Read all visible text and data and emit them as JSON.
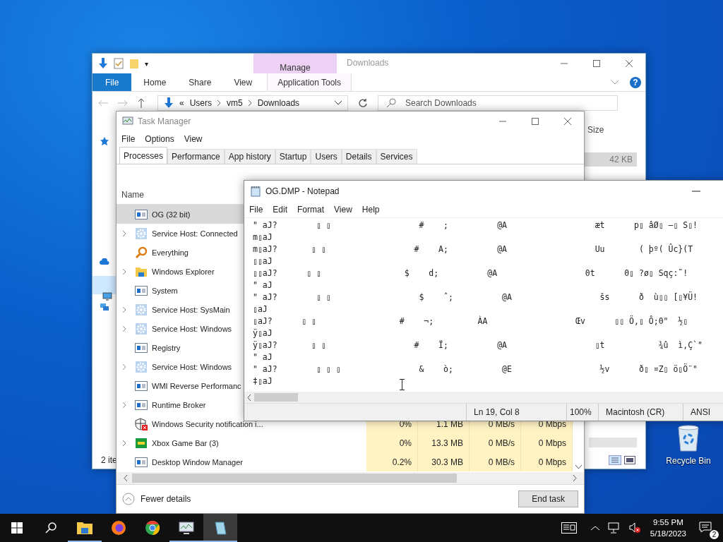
{
  "explorer": {
    "title": "Downloads",
    "context_tab": "Manage",
    "qat_caret": "▾",
    "ribbon_tabs": [
      {
        "label": "File",
        "kind": "file"
      },
      {
        "label": "Home",
        "kind": "plain"
      },
      {
        "label": "Share",
        "kind": "plain"
      },
      {
        "label": "View",
        "kind": "plain"
      },
      {
        "label": "Application Tools",
        "kind": "context"
      }
    ],
    "help": "?",
    "address_prefix": "«",
    "address": [
      "Users",
      "vm5",
      "Downloads"
    ],
    "search": {
      "placeholder": "Search Downloads"
    },
    "size_header": "Size",
    "files": [
      {
        "size": "42 KB",
        "selected": true
      }
    ],
    "status": "2 ite"
  },
  "task_manager": {
    "title": "Task Manager",
    "menu": [
      "File",
      "Options",
      "View"
    ],
    "tabs": [
      {
        "label": "Processes",
        "selected": true
      },
      {
        "label": "Performance",
        "selected": false
      },
      {
        "label": "App history",
        "selected": false
      },
      {
        "label": "Startup",
        "selected": false
      },
      {
        "label": "Users",
        "selected": false
      },
      {
        "label": "Details",
        "selected": false
      },
      {
        "label": "Services",
        "selected": false
      }
    ],
    "name_header": "Name",
    "processes": [
      {
        "name": "OG (32 bit)",
        "kind": "app",
        "expandable": false,
        "selected": true
      },
      {
        "name": "Service Host: Connected",
        "kind": "service",
        "expandable": true,
        "selected": false
      },
      {
        "name": "Everything",
        "kind": "search",
        "expandable": false,
        "selected": false
      },
      {
        "name": "Windows Explorer",
        "kind": "folder",
        "expandable": true,
        "selected": false
      },
      {
        "name": "System",
        "kind": "app",
        "expandable": false,
        "selected": false
      },
      {
        "name": "Service Host: SysMain",
        "kind": "service",
        "expandable": true,
        "selected": false
      },
      {
        "name": "Service Host: Windows",
        "kind": "service",
        "expandable": true,
        "selected": false
      },
      {
        "name": "Registry",
        "kind": "app",
        "expandable": false,
        "selected": false
      },
      {
        "name": "Service Host: Windows",
        "kind": "service",
        "expandable": true,
        "selected": false
      },
      {
        "name": "WMI Reverse Performanc",
        "kind": "app",
        "expandable": false,
        "selected": false
      },
      {
        "name": "Runtime Broker",
        "kind": "app",
        "expandable": true,
        "selected": false
      },
      {
        "name": "Windows Security notification i...",
        "kind": "shield",
        "expandable": false,
        "selected": false,
        "values": [
          "0%",
          "1.1 MB",
          "0 MB/s",
          "0 Mbps"
        ]
      },
      {
        "name": "Xbox Game Bar (3)",
        "kind": "game",
        "expandable": true,
        "selected": false,
        "values": [
          "0%",
          "13.3 MB",
          "0 MB/s",
          "0 Mbps"
        ]
      },
      {
        "name": "Desktop Window Manager",
        "kind": "app",
        "expandable": false,
        "selected": false,
        "values": [
          "0.2%",
          "30.3 MB",
          "0 MB/s",
          "0 Mbps"
        ]
      }
    ],
    "fewer_details": "Fewer details",
    "end_task": "End task"
  },
  "notepad": {
    "title": "OG.DMP - Notepad",
    "menu": [
      "File",
      "Edit",
      "Format",
      "View",
      "Help"
    ],
    "lines": [
      "\" aJ?        ▯ ▯                  #    ;          @A                  æt      p▯ âØ▯ –▯ S▯!",
      "m▯aJ",
      "m▯aJ?       ▯ ▯                  #    A;          @A                  Uu       ( þº( Ûc}(T",
      "▯▯aJ",
      "▯▯aJ?      ▯ ▯                 $    d;          @A                  0t      0▯ ?ø▯ Sqç:˜!",
      "\" aJ",
      "\" aJ?        ▯ ▯                  $    ˆ;          @A                  šs      ð  ù▯▯ [▯¥Ü!",
      "▯aJ",
      "▯aJ?      ▯ ▯                 #    ¬;         ÀA                  Œv      ▯▯ Ö,▯ Ô;0\"  ½▯",
      "ÿ▯aJ",
      "ÿ▯aJ?       ▯ ▯                  #    Ï;          @A                  ▯t           ¾û  ì,Ç`\"",
      "\" aJ",
      "\" aJ?        ▯ ▯ ▯                &    ò;          @E                  ½v      ð▯ ¤Z▯ ö▯Ö¨\"",
      "‡▯aJ"
    ],
    "status": [
      "Ln 19, Col 8",
      "100%",
      "Macintosh (CR)",
      "ANSI"
    ]
  },
  "desktop_icons": [
    {
      "label": "Recycle Bin"
    }
  ],
  "taskbar": {
    "apps": [
      {
        "kind": "explorer",
        "running": true,
        "active": false
      },
      {
        "kind": "firefox",
        "running": false,
        "active": false
      },
      {
        "kind": "chrome",
        "running": false,
        "active": false
      },
      {
        "kind": "taskmgr",
        "running": true,
        "active": false
      },
      {
        "kind": "notepad",
        "running": true,
        "active": true
      }
    ],
    "time": "9:55 PM",
    "date": "5/18/2023",
    "notifications": "2"
  }
}
